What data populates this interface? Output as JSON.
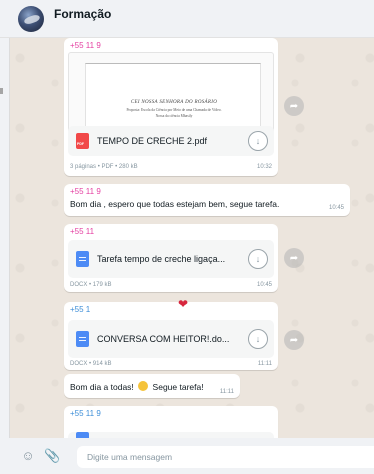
{
  "header": {
    "title": "Formação"
  },
  "messages": {
    "pdf": {
      "sender": "+55 11 9",
      "preview_line1": "CEI NOSSA SENHORA DO ROSÁRIO",
      "preview_line2": "Proposta: Escola da Ciência por Meio de uma Chamada de Vídeo.",
      "preview_line3": "Nossa da ciência Mbasily",
      "file_name": "TEMPO DE CRECHE 2.pdf",
      "meta": "3 páginas • PDF • 280 kB",
      "time": "10:32",
      "file_icon": "pdf-icon"
    },
    "text1": {
      "sender": "+55 11 9",
      "text": "Bom dia , espero que todas estejam bem, segue tarefa.",
      "time": "10:45"
    },
    "doc1": {
      "sender": "+55 11",
      "file_name": "Tarefa tempo de creche ligaça...",
      "meta": "DOCX • 179 kB",
      "time": "10:45"
    },
    "doc2": {
      "sender": "+55 1",
      "reaction": "heart-emoji",
      "file_name": "CONVERSA COM HEITOR!.do...",
      "meta": "DOCX • 914 kB",
      "time": "11:11"
    },
    "text2": {
      "text_before": "Bom dia a todas!",
      "emoji": "blushing-face-emoji",
      "text_after": "Segue tarefa!",
      "time": "11:11"
    },
    "partial": {
      "sender": "+55 11 9"
    }
  },
  "footer": {
    "emoji_icon": "smiley-icon",
    "attach_icon": "paperclip-icon",
    "placeholder": "Digite uma mensagem"
  },
  "colors": {
    "wallpaper": "#ece5dd",
    "bubble": "#ffffff",
    "header_bg": "#f0f2f5",
    "sender_pink": "#e542a3",
    "sender_blue": "#3f8fd8",
    "pdf_red": "#f14848",
    "doc_blue": "#4d8bf5"
  }
}
